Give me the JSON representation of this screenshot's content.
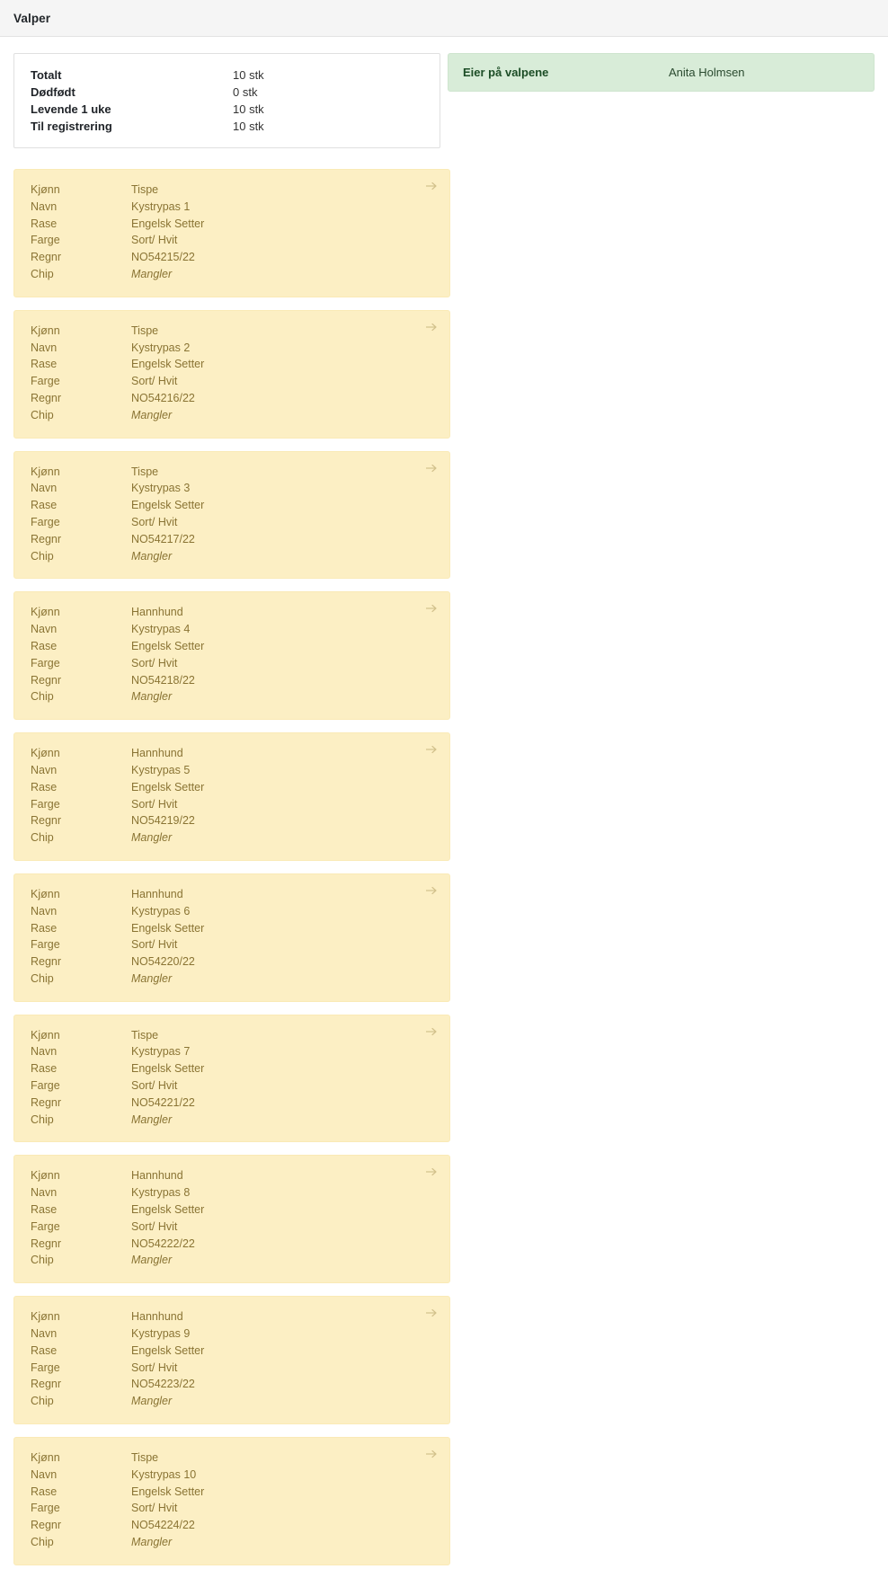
{
  "header": {
    "title": "Valper"
  },
  "summary": {
    "rows": [
      {
        "label": "Totalt",
        "value": "10 stk"
      },
      {
        "label": "Dødfødt",
        "value": "0 stk"
      },
      {
        "label": "Levende 1 uke",
        "value": "10 stk"
      },
      {
        "label": "Til registrering",
        "value": "10 stk"
      }
    ]
  },
  "owner": {
    "label": "Eier på valpene",
    "value": "Anita Holmsen"
  },
  "field_labels": {
    "kjonn": "Kjønn",
    "navn": "Navn",
    "rase": "Rase",
    "farge": "Farge",
    "regnr": "Regnr",
    "chip": "Chip"
  },
  "icons": {
    "card_arrow": "arrow-right-icon"
  },
  "colors": {
    "card_bg": "#fcefc4",
    "card_border": "#faeab6",
    "card_text": "#8a7434",
    "owner_bg": "#d8ecd8",
    "owner_border": "#cfe5cf",
    "owner_label_text": "#1c4d26",
    "header_bg": "#f5f5f5"
  },
  "puppies": [
    {
      "kjonn": "Tispe",
      "navn": "Kystrypas 1",
      "rase": "Engelsk Setter",
      "farge": "Sort/ Hvit",
      "regnr": "NO54215/22",
      "chip": "Mangler"
    },
    {
      "kjonn": "Tispe",
      "navn": "Kystrypas 2",
      "rase": "Engelsk Setter",
      "farge": "Sort/ Hvit",
      "regnr": "NO54216/22",
      "chip": "Mangler"
    },
    {
      "kjonn": "Tispe",
      "navn": "Kystrypas 3",
      "rase": "Engelsk Setter",
      "farge": "Sort/ Hvit",
      "regnr": "NO54217/22",
      "chip": "Mangler"
    },
    {
      "kjonn": "Hannhund",
      "navn": "Kystrypas 4",
      "rase": "Engelsk Setter",
      "farge": "Sort/ Hvit",
      "regnr": "NO54218/22",
      "chip": "Mangler"
    },
    {
      "kjonn": "Hannhund",
      "navn": "Kystrypas 5",
      "rase": "Engelsk Setter",
      "farge": "Sort/ Hvit",
      "regnr": "NO54219/22",
      "chip": "Mangler"
    },
    {
      "kjonn": "Hannhund",
      "navn": "Kystrypas 6",
      "rase": "Engelsk Setter",
      "farge": "Sort/ Hvit",
      "regnr": "NO54220/22",
      "chip": "Mangler"
    },
    {
      "kjonn": "Tispe",
      "navn": "Kystrypas 7",
      "rase": "Engelsk Setter",
      "farge": "Sort/ Hvit",
      "regnr": "NO54221/22",
      "chip": "Mangler"
    },
    {
      "kjonn": "Hannhund",
      "navn": "Kystrypas 8",
      "rase": "Engelsk Setter",
      "farge": "Sort/ Hvit",
      "regnr": "NO54222/22",
      "chip": "Mangler"
    },
    {
      "kjonn": "Hannhund",
      "navn": "Kystrypas 9",
      "rase": "Engelsk Setter",
      "farge": "Sort/ Hvit",
      "regnr": "NO54223/22",
      "chip": "Mangler"
    },
    {
      "kjonn": "Tispe",
      "navn": "Kystrypas 10",
      "rase": "Engelsk Setter",
      "farge": "Sort/ Hvit",
      "regnr": "NO54224/22",
      "chip": "Mangler"
    }
  ]
}
